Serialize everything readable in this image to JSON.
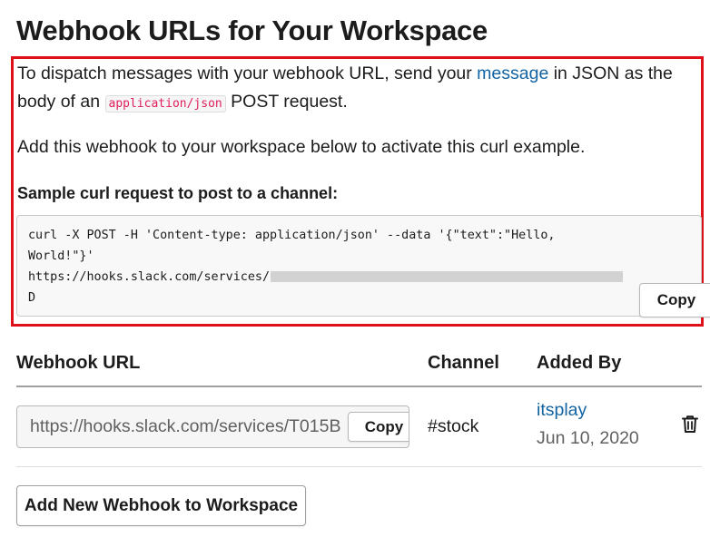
{
  "page": {
    "title": "Webhook URLs for Your Workspace"
  },
  "instructions": {
    "intro_before_link": "To dispatch messages with your webhook URL, send your ",
    "link_text": "message",
    "intro_after_link": " in JSON as the body of an ",
    "inline_code": "application/json",
    "intro_end": " POST request.",
    "activate_text": "Add this webhook to your workspace below to activate this curl example.",
    "sample_heading": "Sample curl request to post to a channel:",
    "code_line1": "curl -X POST -H 'Content-type: application/json' --data '{\"text\":\"Hello,",
    "code_line2": "World!\"}'",
    "code_line3": "https://hooks.slack.com/services/",
    "code_line4": "D",
    "copy_label": "Copy"
  },
  "table": {
    "headers": {
      "webhook_url": "Webhook URL",
      "channel": "Channel",
      "added_by": "Added By"
    },
    "rows": [
      {
        "url": "https://hooks.slack.com/services/T015B",
        "copy_label": "Copy",
        "channel": "#stock",
        "added_by_user": "itsplay",
        "added_date": "Jun 10, 2020",
        "delete_icon": "trash-icon"
      }
    ]
  },
  "actions": {
    "add_webhook_label": "Add New Webhook to Workspace"
  },
  "colors": {
    "highlight_border": "#e0101a",
    "link": "#1264a3",
    "inline_code": "#e01e5a",
    "text": "#1d1c1d",
    "muted": "#616061"
  }
}
